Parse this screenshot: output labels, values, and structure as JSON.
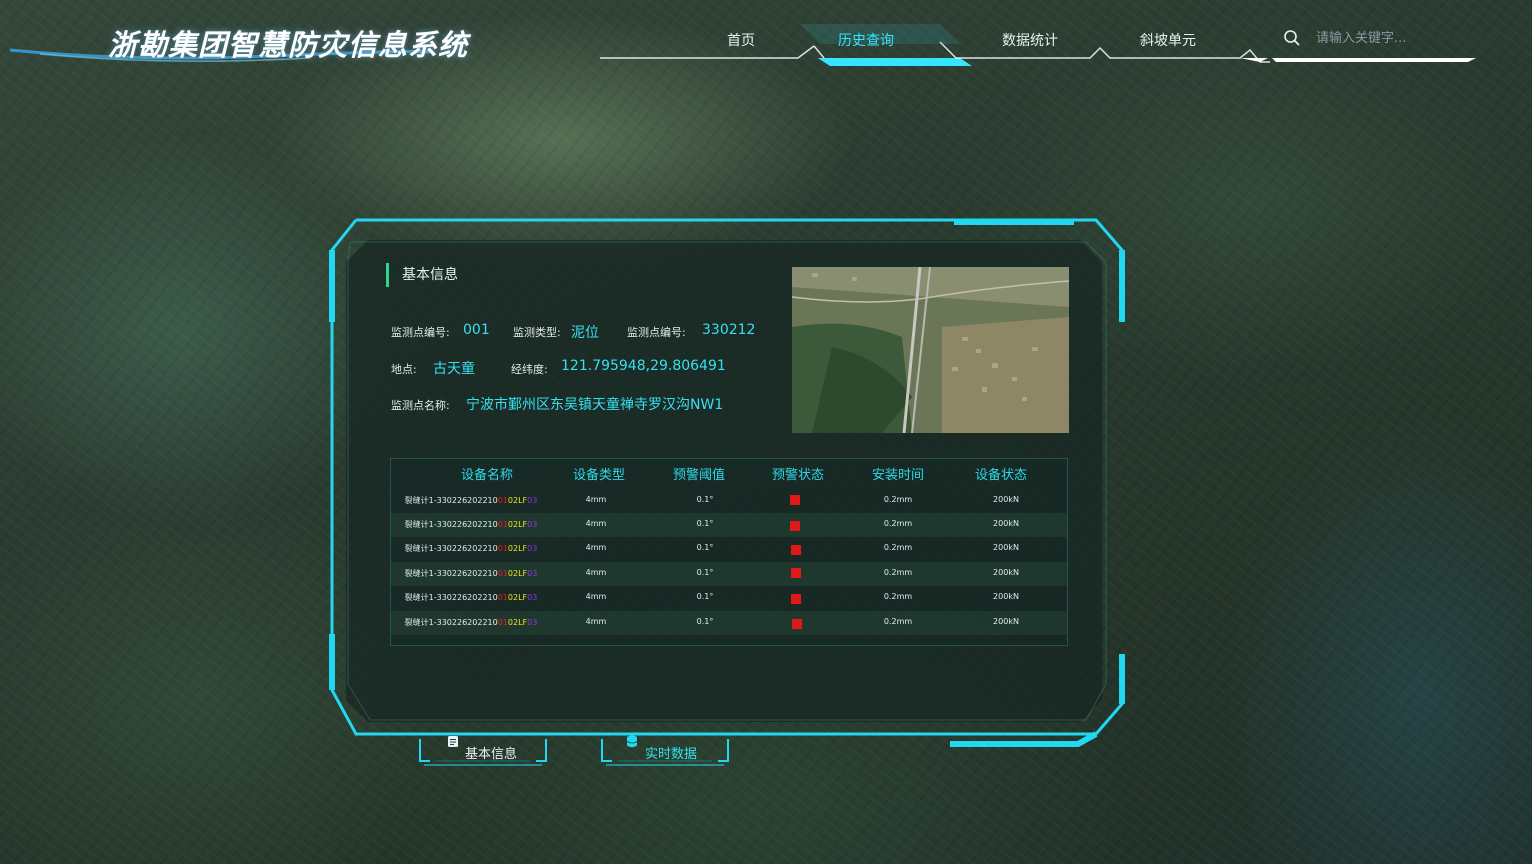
{
  "header": {
    "app_title": "浙勘集团智慧防灾信息系统",
    "nav": [
      {
        "label": "首页"
      },
      {
        "label": "历史查询"
      },
      {
        "label": "数据统计"
      },
      {
        "label": "斜坡单元"
      }
    ],
    "active_nav": "历史查询",
    "search": {
      "placeholder": "请输入关键字..."
    }
  },
  "panel": {
    "section_title": "基本信息",
    "info": {
      "point_id_label": "监测点编号:",
      "point_id_value": "001",
      "monitor_type_label": "监测类型:",
      "monitor_type_value": "泥位",
      "monitor_code_label": "监测点编号:",
      "monitor_code_value": "330212",
      "location_label": "地点:",
      "location_value": "古天童",
      "coords_label": "经纬度:",
      "coords_value": "121.795948,29.806491",
      "point_name_label": "监测点名称:",
      "point_name_value": "宁波市鄞州区东吴镇天童禅寺罗汉沟NW1"
    },
    "table": {
      "headers": [
        "设备名称",
        "设备类型",
        "预警阈值",
        "预警状态",
        "安装时间",
        "设备状态"
      ],
      "rows": [
        {
          "name_a": "裂缝计1-330226202210",
          "name_b": "01",
          "name_c": "02LF",
          "name_d": "03",
          "type": "4mm",
          "threshold": "0.1°",
          "install": "0.2mm",
          "status": "200kN"
        },
        {
          "name_a": "裂缝计1-330226202210",
          "name_b": "01",
          "name_c": "02LF",
          "name_d": "03",
          "type": "4mm",
          "threshold": "0.1°",
          "install": "0.2mm",
          "status": "200kN"
        },
        {
          "name_a": "裂缝计1-330226202210",
          "name_b": "01",
          "name_c": "02LF",
          "name_d": "03",
          "type": "4mm",
          "threshold": "0.1°",
          "install": "0.2mm",
          "status": "200kN"
        },
        {
          "name_a": "裂缝计1-330226202210",
          "name_b": "01",
          "name_c": "02LF",
          "name_d": "03",
          "type": "4mm",
          "threshold": "0.1°",
          "install": "0.2mm",
          "status": "200kN"
        },
        {
          "name_a": "裂缝计1-330226202210",
          "name_b": "01",
          "name_c": "02LF",
          "name_d": "03",
          "type": "4mm",
          "threshold": "0.1°",
          "install": "0.2mm",
          "status": "200kN"
        },
        {
          "name_a": "裂缝计1-330226202210",
          "name_b": "01",
          "name_c": "02LF",
          "name_d": "03",
          "type": "4mm",
          "threshold": "0.1°",
          "install": "0.2mm",
          "status": "200kN"
        }
      ]
    }
  },
  "tabs": [
    {
      "label": "基本信息",
      "icon": "document-icon"
    },
    {
      "label": "实时数据",
      "icon": "database-icon"
    }
  ],
  "colors": {
    "accent": "#36e6ff",
    "frame": "#22d8f0",
    "warn": "#e01818",
    "section_bar": "#2fd58c"
  }
}
